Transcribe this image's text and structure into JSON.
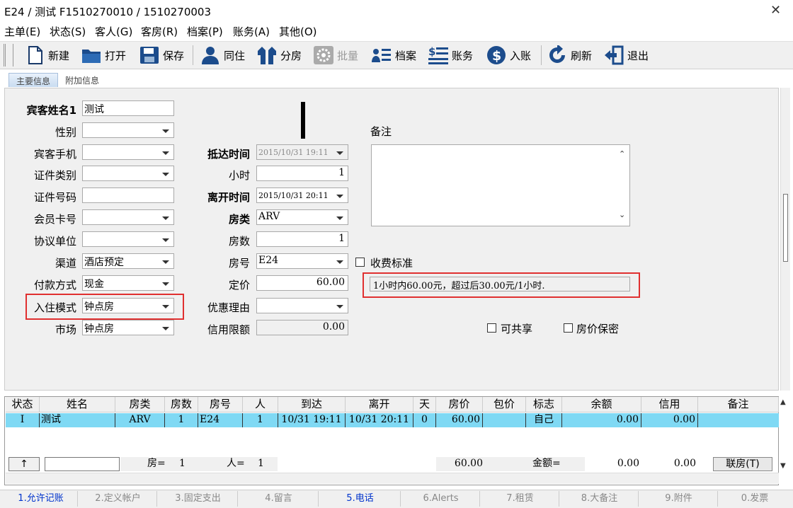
{
  "window": {
    "title": "E24 / 测试 F1510270010 / 1510270003",
    "close": "✕"
  },
  "menu": [
    "主单(E)",
    "状态(S)",
    "客人(G)",
    "客房(R)",
    "档案(P)",
    "账务(A)",
    "其他(O)"
  ],
  "toolbar": {
    "new": "新建",
    "open": "打开",
    "save": "保存",
    "share": "同住",
    "split": "分房",
    "batch": "批量",
    "archive": "档案",
    "account": "账务",
    "post": "入账",
    "refresh": "刷新",
    "exit": "退出"
  },
  "tabs": {
    "main": "主要信息",
    "extra": "附加信息"
  },
  "form": {
    "guest_name_label": "宾客姓名1",
    "guest_name": "测试",
    "gender_label": "性别",
    "gender": "",
    "mobile_label": "宾客手机",
    "mobile": "",
    "id_type_label": "证件类别",
    "id_type": "",
    "id_no_label": "证件号码",
    "id_no": "",
    "member_label": "会员卡号",
    "member": "",
    "agreement_label": "协议单位",
    "agreement": "",
    "channel_label": "渠道",
    "channel": "酒店预定",
    "payment_label": "付款方式",
    "payment": "现金",
    "mode_label": "入住模式",
    "mode": "钟点房",
    "market_label": "市场",
    "market": "钟点房",
    "arrive_label": "抵达时间",
    "arrive": "2015/10/31 19:11",
    "hours_label": "小时",
    "hours": "1",
    "depart_label": "离开时间",
    "depart": "2015/10/31 20:11",
    "roomtype_label": "房类",
    "roomtype": "ARV",
    "rooms_label": "房数",
    "rooms": "1",
    "roomno_label": "房号",
    "roomno": "E24",
    "price_label": "定价",
    "price": "60.00",
    "discount_label": "优惠理由",
    "discount": "",
    "credit_label": "信用限额",
    "credit": "0.00",
    "remark_label": "备注",
    "fee_std_label": "收费标准",
    "fee_desc": "1小时内60.00元，超过后30.00元/1小时.",
    "shareable_label": "可共享",
    "price_secret_label": "房价保密"
  },
  "grid": {
    "headers": [
      "状态",
      "姓名",
      "房类",
      "房数",
      "房号",
      "人",
      "到达",
      "离开",
      "天",
      "房价",
      "包价",
      "标志",
      "余额",
      "信用",
      "备注"
    ],
    "row": [
      "I",
      "测试",
      "ARV",
      "1",
      "E24",
      "1",
      "10/31 19:11",
      "10/31 20:11",
      "0",
      "60.00",
      "",
      "自己",
      "0.00",
      "0.00",
      ""
    ],
    "footer": {
      "up": "↑",
      "room_label": "房=",
      "room": "1",
      "people_label": "人=",
      "people": "1",
      "price": "60.00",
      "amount_label": "金额=",
      "amount": "0.00",
      "credit": "0.00",
      "link": "联房(T)"
    }
  },
  "bottom_tabs": [
    "1.允许记账",
    "2.定义帐户",
    "3.固定支出",
    "4.留言",
    "5.电话",
    "6.Alerts",
    "7.租赁",
    "8.大备注",
    "9.附件",
    "0.发票"
  ]
}
